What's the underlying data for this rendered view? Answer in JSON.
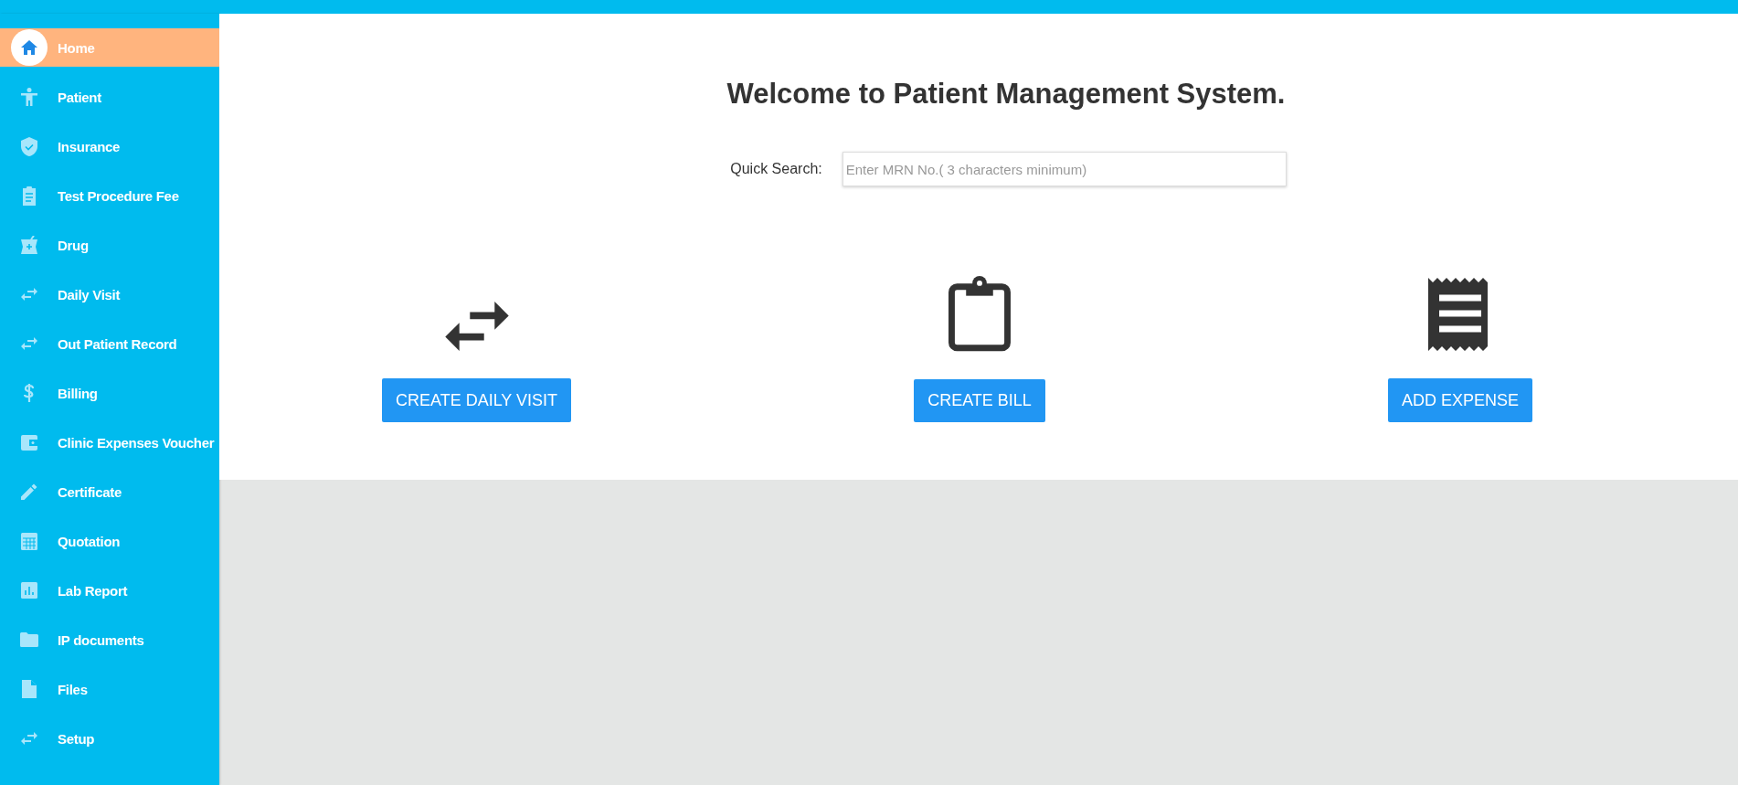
{
  "sidebar": {
    "items": [
      {
        "label": "Home",
        "selected": true
      },
      {
        "label": "Patient",
        "selected": false
      },
      {
        "label": "Insurance",
        "selected": false
      },
      {
        "label": "Test Procedure Fee",
        "selected": false
      },
      {
        "label": "Drug",
        "selected": false
      },
      {
        "label": "Daily Visit",
        "selected": false
      },
      {
        "label": "Out Patient Record",
        "selected": false
      },
      {
        "label": "Billing",
        "selected": false
      },
      {
        "label": "Clinic Expenses Voucher",
        "selected": false
      },
      {
        "label": "Certificate",
        "selected": false
      },
      {
        "label": "Quotation",
        "selected": false
      },
      {
        "label": "Lab Report",
        "selected": false
      },
      {
        "label": "IP documents",
        "selected": false
      },
      {
        "label": "Files",
        "selected": false
      },
      {
        "label": "Setup",
        "selected": false
      }
    ]
  },
  "main": {
    "title": "Welcome to Patient Management System.",
    "quick_search": {
      "label": "Quick Search:",
      "placeholder": "Enter MRN No.( 3 characters minimum)"
    },
    "actions": [
      {
        "label": "CREATE DAILY VISIT"
      },
      {
        "label": "CREATE BILL"
      },
      {
        "label": "ADD EXPENSE"
      }
    ]
  }
}
